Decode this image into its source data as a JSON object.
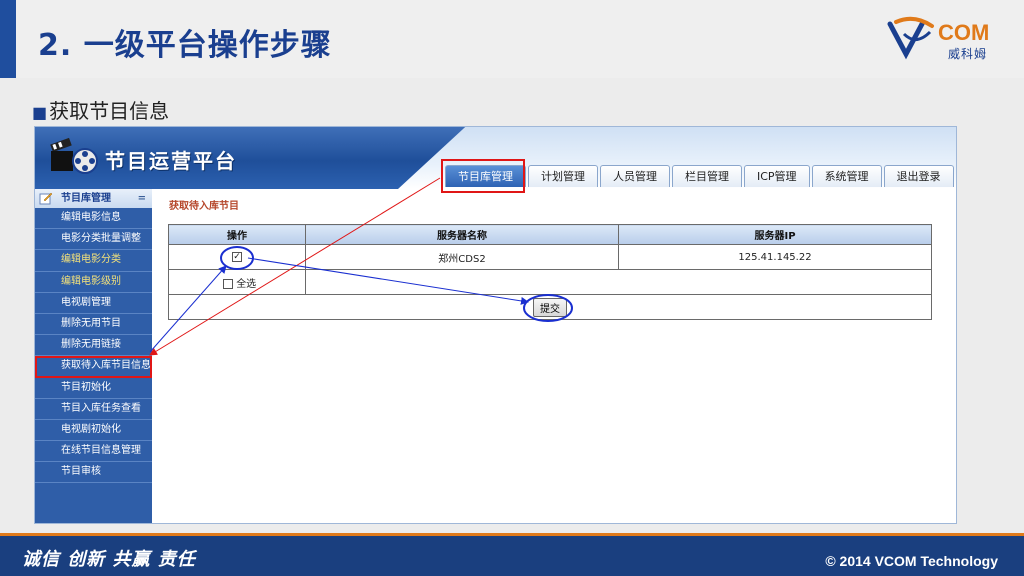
{
  "slide": {
    "title": "2. 一级平台操作步骤",
    "bullet": "获取节目信息",
    "logo_text": "COM",
    "logo_sub": "威科姆"
  },
  "app": {
    "title": "节目运营平台",
    "tabs": [
      {
        "label": "节目库管理",
        "active": true
      },
      {
        "label": "计划管理"
      },
      {
        "label": "人员管理"
      },
      {
        "label": "栏目管理"
      },
      {
        "label": "ICP管理"
      },
      {
        "label": "系统管理"
      },
      {
        "label": "退出登录"
      }
    ],
    "sidebar": {
      "header": "节目库管理",
      "collapse_symbol": "=",
      "items": [
        {
          "label": "编辑电影信息"
        },
        {
          "label": "电影分类批量调整"
        },
        {
          "label": "编辑电影分类"
        },
        {
          "label": "编辑电影级别"
        },
        {
          "label": "电视剧管理"
        },
        {
          "label": "删除无用节目"
        },
        {
          "label": "删除无用链接"
        },
        {
          "label": "获取待入库节目信息"
        },
        {
          "label": "节目初始化"
        },
        {
          "label": "节目入库任务查看"
        },
        {
          "label": "电视剧初始化"
        },
        {
          "label": "在线节目信息管理"
        },
        {
          "label": "节目审核"
        }
      ]
    },
    "content": {
      "title": "获取待入库节目",
      "table": {
        "headers": [
          "操作",
          "服务器名称",
          "服务器IP"
        ],
        "rows": [
          {
            "server_name": "郑州CDS2",
            "server_ip": "125.41.145.22",
            "checked": true
          }
        ],
        "select_all_label": "全选",
        "submit_label": "提交"
      }
    }
  },
  "footer": {
    "slogan": "诚信 创新 共赢 责任",
    "copyright": "© 2014 VCOM Technology"
  },
  "colors": {
    "title_blue": "#1a3f8f",
    "accent_orange": "#e07a1a",
    "annotation_red": "#e01616",
    "annotation_blue": "#1a2fd0"
  }
}
